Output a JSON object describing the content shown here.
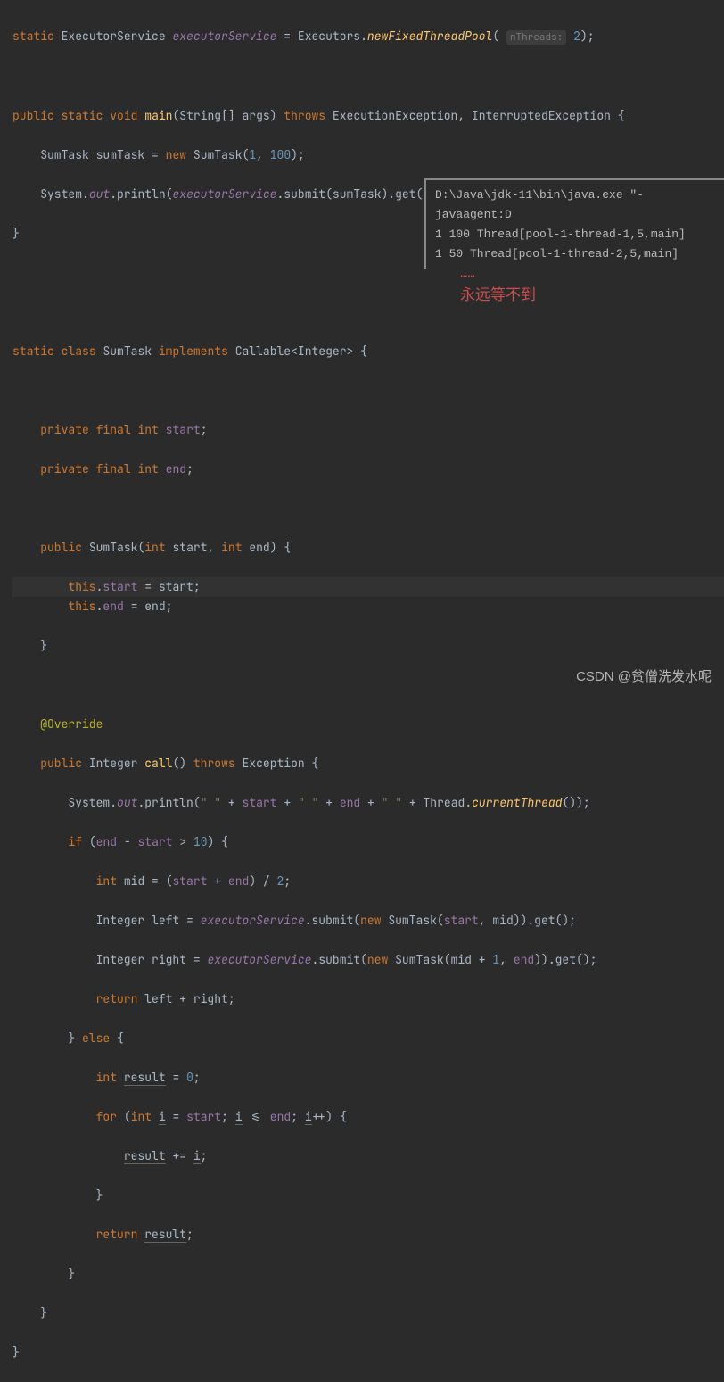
{
  "code": {
    "l1": {
      "kw1": "static",
      "type": "ExecutorService",
      "field": "executorService",
      "eq": "=",
      "cls": "Executors",
      "dot": ".",
      "method": "newFixedThreadPool",
      "hint": "nThreads:",
      "num": "2",
      "end": ");"
    },
    "l2": {
      "kw1": "public",
      "kw2": "static",
      "kw3": "void",
      "method": "main",
      "args": "(String[] args)",
      "kw4": "throws",
      "ex1": "ExecutionException",
      "comma": ",",
      "ex2": "InterruptedException",
      "brace": "{"
    },
    "l3": {
      "type": "SumTask",
      "var": "sumTask",
      "eq": "=",
      "kw": "new",
      "cls": "SumTask",
      "open": "(",
      "n1": "1",
      "comma": ",",
      "n2": "100",
      "close": ");"
    },
    "l4": {
      "cls": "System",
      "dot1": ".",
      "out": "out",
      "dot2": ".",
      "println": "println",
      "open": "(",
      "svc": "executorService",
      "dot3": ".",
      "submit": "submit(sumTask).get());"
    },
    "l5": {
      "brace": "}"
    },
    "l6": {
      "kw1": "static",
      "kw2": "class",
      "cls": "SumTask",
      "kw3": "implements",
      "iface": "Callable<Integer>",
      "brace": "{"
    },
    "l7": {
      "kw1": "private",
      "kw2": "final",
      "kw3": "int",
      "field": "start",
      "semi": ";"
    },
    "l8": {
      "kw1": "private",
      "kw2": "final",
      "kw3": "int",
      "field": "end",
      "semi": ";"
    },
    "l9": {
      "kw1": "public",
      "ctor": "SumTask",
      "open": "(",
      "kw2": "int",
      "p1": "start",
      "comma": ",",
      "kw3": "int",
      "p2": "end",
      "close": ") {"
    },
    "l10": {
      "kw": "this",
      "dot": ".",
      "field": "start",
      "eq": "= start;"
    },
    "l11": {
      "kw": "this",
      "dot": ".",
      "field": "end",
      "eq": "= end;"
    },
    "l12": {
      "brace": "}"
    },
    "l13": {
      "anno": "@Override"
    },
    "l14": {
      "kw1": "public",
      "type": "Integer",
      "method": "call",
      "paren": "()",
      "kw2": "throws",
      "ex": "Exception",
      "brace": "{"
    },
    "l15": {
      "cls": "System",
      "dot1": ".",
      "out": "out",
      "dot2": ".",
      "println": "println",
      "open": "(",
      "s1": "\" \"",
      "p1": "+",
      "f1": "start",
      "p2": "+",
      "s2": "\" \"",
      "p3": "+",
      "f2": "end",
      "p4": "+",
      "s3": "\" \"",
      "p5": "+",
      "thread": "Thread",
      "dot3": ".",
      "ct": "currentThread",
      "close": "());"
    },
    "l16": {
      "kw": "if",
      "open": "(",
      "f1": "end",
      "minus": "-",
      "f2": "start",
      "gt": ">",
      "n": "10",
      "close": ") {"
    },
    "l17": {
      "kw": "int",
      "var": "mid",
      "eq": "= (",
      "f1": "start",
      "plus": "+",
      "f2": "end",
      "close": ") /",
      "n": "2",
      "semi": ";"
    },
    "l18": {
      "type": "Integer",
      "var": "left",
      "eq": "=",
      "svc": "executorService",
      "submit": ".submit(",
      "kw": "new",
      "cls": "SumTask(",
      "f1": "start",
      "comma": ",",
      "var2": "mid)).get();"
    },
    "l19": {
      "type": "Integer",
      "var": "right",
      "eq": "=",
      "svc": "executorService",
      "submit": ".submit(",
      "kw": "new",
      "cls": "SumTask(mid",
      "plus": "+",
      "n": "1",
      "comma": ",",
      "f2": "end",
      ")).get();": "",
      "close": ")).get();"
    },
    "l20": {
      "kw": "return",
      "expr": "left + right;"
    },
    "l21": {
      "brace": "}",
      "kw": "else",
      "brace2": "{"
    },
    "l22": {
      "kw": "int",
      "var": "result",
      "eq": "=",
      "n": "0",
      "semi": ";"
    },
    "l23": {
      "kw1": "for",
      "open": "(",
      "kw2": "int",
      "i": "i",
      "eq": "=",
      "f": "start",
      "semi": ";",
      "i2": "i",
      "le": "<=",
      "f2": "end",
      "semi2": ";",
      "i3": "i",
      "inc": "++) {"
    },
    "l24": {
      "var": "result",
      "pe": "+=",
      "i": "i",
      "semi": ";"
    },
    "l25": {
      "brace": "}"
    },
    "l26": {
      "kw": "return",
      "var": "result",
      "semi": ";"
    },
    "l27": {
      "brace": "}"
    },
    "l28": {
      "brace": "}"
    },
    "l29": {
      "brace": "}"
    }
  },
  "console": {
    "l1": "D:\\Java\\jdk-11\\bin\\java.exe \"-javaagent:D",
    "l2": " 1 100 Thread[pool-1-thread-1,5,main]",
    "l3": " 1 50 Thread[pool-1-thread-2,5,main]"
  },
  "annotation": {
    "dots": "……",
    "text": "永远等不到"
  },
  "watermark": "CSDN @贫僧洗发水呢"
}
